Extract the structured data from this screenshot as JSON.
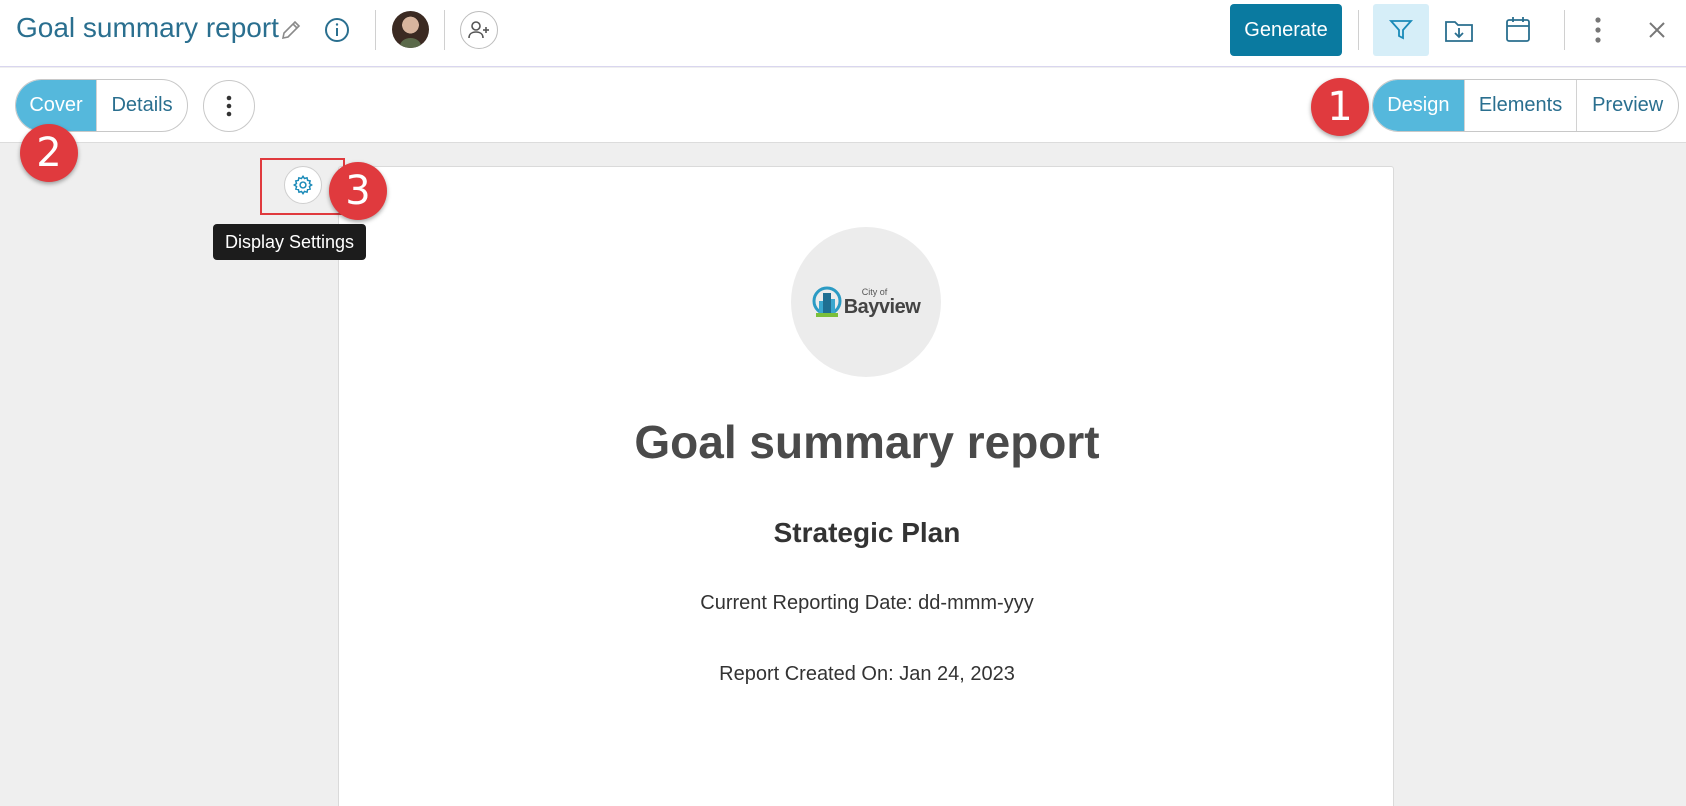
{
  "header": {
    "title": "Goal summary report",
    "generate_label": "Generate",
    "icons": [
      "pencil-icon",
      "info-icon",
      "avatar",
      "add-user-icon",
      "filter-icon",
      "folder-download-icon",
      "calendar-icon",
      "more-vertical-icon",
      "close-icon"
    ]
  },
  "left_tabs": [
    {
      "label": "Cover",
      "active": true
    },
    {
      "label": "Details",
      "active": false
    }
  ],
  "right_tabs": [
    {
      "label": "Design",
      "active": true
    },
    {
      "label": "Elements",
      "active": false
    },
    {
      "label": "Preview",
      "active": false
    }
  ],
  "callouts": [
    "1",
    "2",
    "3"
  ],
  "tooltip": "Display Settings",
  "document": {
    "logo_small": "City of",
    "logo_big": "Bayview",
    "title": "Goal summary report",
    "subtitle": "Strategic Plan",
    "reporting_date": "Current Reporting Date: dd-mmm-yyy",
    "created_on": "Report Created On: Jan 24, 2023"
  },
  "colors": {
    "accent": "#0a7aa0",
    "active_tab": "#55b8dc",
    "callout": "#e03a3e",
    "title_text": "#2a6f8f"
  }
}
